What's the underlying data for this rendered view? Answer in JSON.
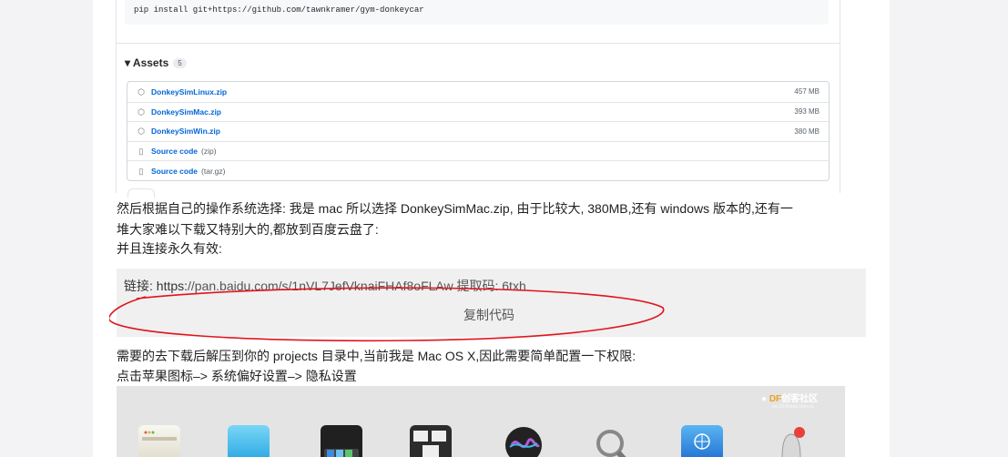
{
  "github": {
    "pip_command": "pip install git+https://github.com/tawnkramer/gym-donkeycar",
    "assets_title": "▾ Assets",
    "assets_count": "5",
    "assets": [
      {
        "name": "DonkeySimLinux.zip",
        "suffix": "",
        "size": "457 MB",
        "icon": "package-icon"
      },
      {
        "name": "DonkeySimMac.zip",
        "suffix": "",
        "size": "393 MB",
        "icon": "package-icon"
      },
      {
        "name": "DonkeySimWin.zip",
        "suffix": "",
        "size": "380 MB",
        "icon": "package-icon"
      },
      {
        "name": "Source code",
        "suffix": "(zip)",
        "size": "",
        "icon": "file-zip-icon"
      },
      {
        "name": "Source code",
        "suffix": "(tar.gz)",
        "size": "",
        "icon": "file-zip-icon"
      }
    ]
  },
  "article": {
    "para1_line1": "然后根据自己的操作系统选择: 我是 mac 所以选择 DonkeySimMac.zip, 由于比较大, 380MB,还有 windows 版本的,还有一",
    "para1_line2": "堆大家难以下载又特别大的,都放到百度云盘了:",
    "para1_line3": "并且连接永久有效:",
    "link_prefix": "链接: https:",
    "link_rest": "//pan.baidu.com/s/1nVL7JefVknaiFHAf8oFLAw 提取码: 6txh",
    "copy_code": "复制代码",
    "para2_line1": "需要的去下载后解压到你的 projects 目录中,当前我是 Mac OS X,因此需要简单配置一下权限:",
    "para2_line2": "点击苹果图标–> 系统偏好设置–> 隐私设置"
  },
  "watermark": {
    "logo_main": "DF",
    "logo_rest": "创客社区",
    "logo_sub": "mc.DFRobot.com.cn"
  },
  "colors": {
    "link_blue": "#0366d6",
    "annotation_red": "#e0141e",
    "copy_box_bg": "#f0f0f0"
  }
}
